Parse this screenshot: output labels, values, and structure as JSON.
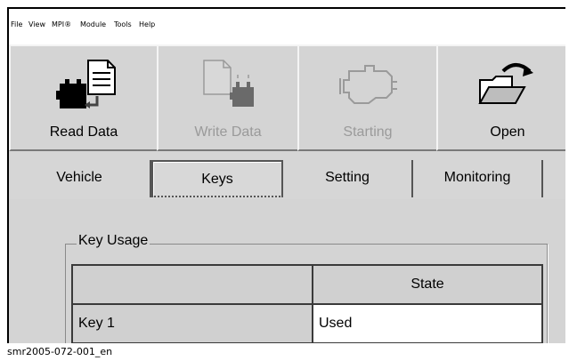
{
  "menu": {
    "items": [
      {
        "label": "File"
      },
      {
        "label": "View"
      },
      {
        "label": "MPI®"
      },
      {
        "label": "Module"
      },
      {
        "label": "Tools"
      },
      {
        "label": "Help"
      }
    ]
  },
  "toolbar": {
    "read_data": {
      "label": "Read Data",
      "icon": "read-data-icon"
    },
    "write_data": {
      "label": "Write Data",
      "icon": "write-data-icon",
      "disabled": true
    },
    "starting": {
      "label": "Starting",
      "icon": "engine-icon",
      "disabled": true
    },
    "open": {
      "label": "Open",
      "icon": "open-folder-icon"
    }
  },
  "tabs": {
    "vehicle": "Vehicle",
    "keys": "Keys",
    "setting": "Setting",
    "monitoring": "Monitoring",
    "active": "Keys"
  },
  "key_usage": {
    "title": "Key Usage",
    "columns": [
      "",
      "State"
    ],
    "rows": [
      {
        "key": "Key 1",
        "state": "Used"
      }
    ]
  },
  "caption": "smr2005-072-001_en",
  "colors": {
    "toolbar_bg": "#d6d6d6",
    "disabled_text": "#9a9a9a",
    "cell_bg": "#ffffff"
  }
}
